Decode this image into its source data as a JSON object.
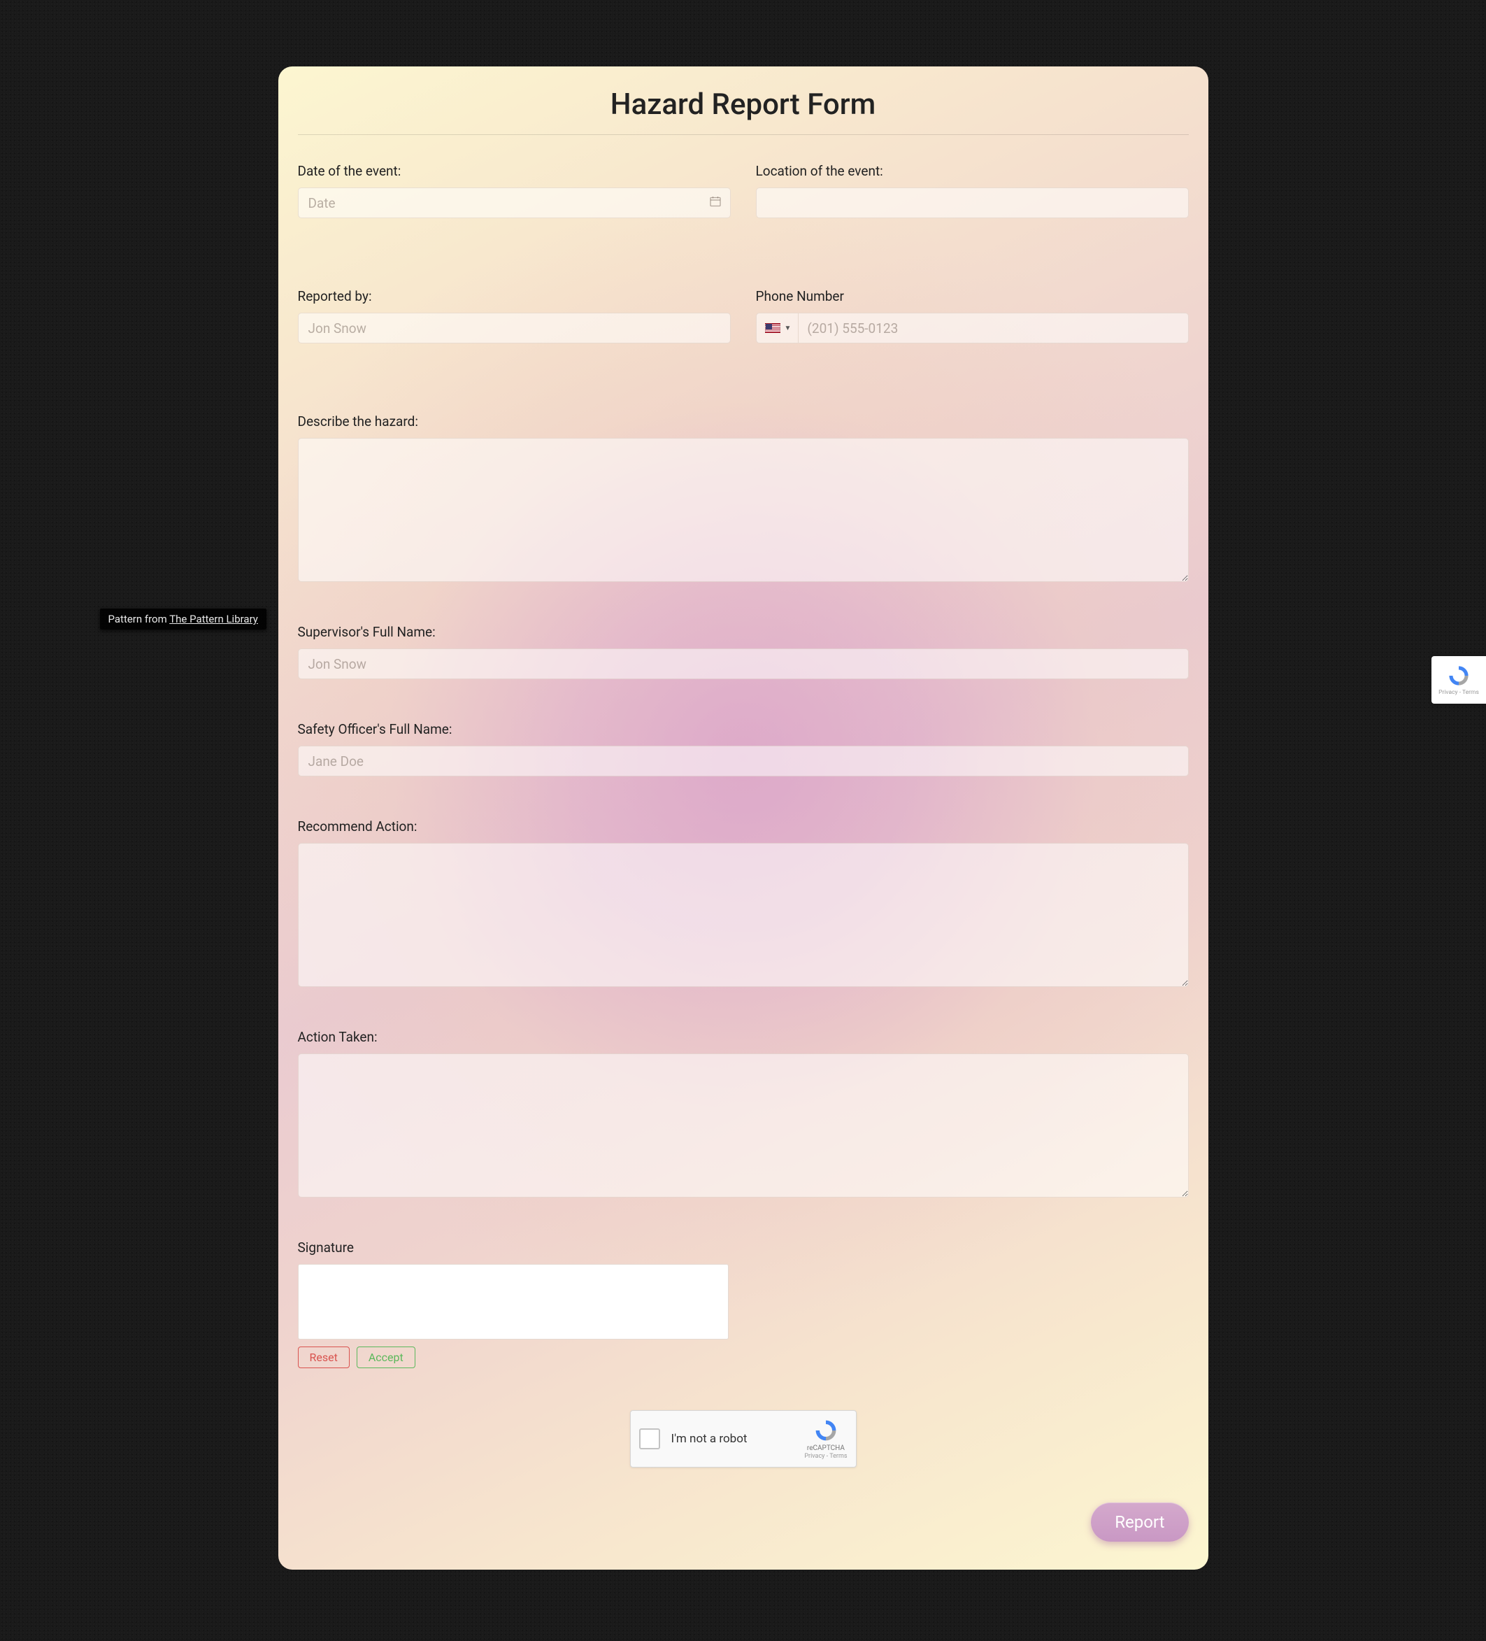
{
  "patternBadge": {
    "prefix": "Pattern from ",
    "link": "The Pattern Library"
  },
  "form": {
    "title": "Hazard Report Form",
    "date": {
      "label": "Date of the event:",
      "placeholder": "Date"
    },
    "location": {
      "label": "Location of the event:"
    },
    "reportedBy": {
      "label": "Reported by:",
      "placeholder": "Jon Snow"
    },
    "phone": {
      "label": "Phone Number",
      "placeholder": "(201) 555-0123",
      "countryCode": "US"
    },
    "hazard": {
      "label": "Describe the hazard:"
    },
    "supervisor": {
      "label": "Supervisor's Full Name:",
      "placeholder": "Jon Snow"
    },
    "safetyOfficer": {
      "label": "Safety Officer's Full Name:",
      "placeholder": "Jane Doe"
    },
    "recommend": {
      "label": "Recommend Action:"
    },
    "actionTaken": {
      "label": "Action Taken:"
    },
    "signature": {
      "label": "Signature",
      "reset": "Reset",
      "accept": "Accept"
    },
    "captcha": {
      "label": "I'm not a robot",
      "brand": "reCAPTCHA",
      "terms": "Privacy - Terms"
    },
    "submit": "Report"
  },
  "floatingCaptcha": {
    "terms": "Privacy - Terms"
  }
}
